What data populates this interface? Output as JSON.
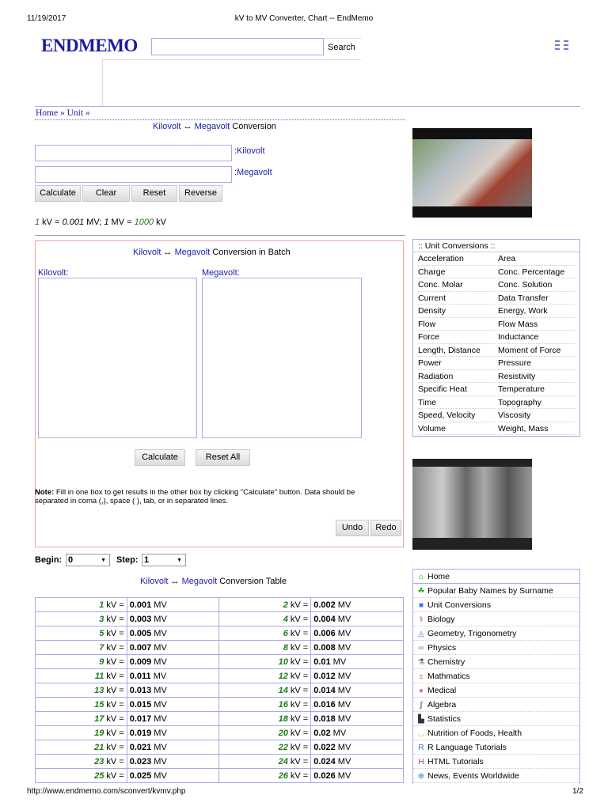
{
  "print_header": {
    "date": "11/19/2017",
    "title": "kV to MV Converter, Chart -- EndMemo"
  },
  "header": {
    "logo": "ENDMEMO",
    "search_placeholder": "",
    "search_button": "Search",
    "menu_icon": "menu-grid-icon"
  },
  "breadcrumb": {
    "home": "Home",
    "sep": " » ",
    "unit": "Unit",
    "end": " »"
  },
  "converter": {
    "from": "Kilovolt",
    "arrow": " ↔ ",
    "to": "Megavolt",
    "suffix": " Conversion",
    "label_from": ":Kilovolt",
    "label_to": ":Megavolt",
    "buttons": [
      "Calculate",
      "Clear",
      "Reset",
      "Reverse"
    ],
    "formula": {
      "a": "1",
      "b": " kV = ",
      "c": "0.001",
      "d": " MV; ",
      "e": "1",
      "f": " MV = ",
      "g": "1000",
      "h": " kV"
    }
  },
  "batch": {
    "from": "Kilovolt",
    "arrow": " ↔ ",
    "to": "Megavolt",
    "suffix": " Conversion in Batch",
    "label_from": "Kilovolt:",
    "label_to": "Megavolt:",
    "calculate": "Calculate",
    "reset_all": "Reset All",
    "note_label": "Note:",
    "note": " Fill in one box to get results in the other box by clicking \"Calculate\" button. Data should be separated in coma (,), space ( ), tab, or in separated lines.",
    "undo": "Undo",
    "redo": "Redo"
  },
  "unit_conversions": {
    "title": ":: Unit Conversions ::",
    "items": [
      "Acceleration",
      "Area",
      "Charge",
      "Conc. Percentage",
      "Conc. Molar",
      "Conc. Solution",
      "Current",
      "Data Transfer",
      "Density",
      "Energy, Work",
      "Flow",
      "Flow Mass",
      "Force",
      "Inductance",
      "Length, Distance",
      "Moment of Force",
      "Power",
      "Pressure",
      "Radiation",
      "Resistivity",
      "Specific Heat",
      "Temperature",
      "Time",
      "Topography",
      "Speed, Velocity",
      "Viscosity",
      "Volume",
      "Weight, Mass"
    ]
  },
  "table_controls": {
    "begin_label": "Begin:",
    "begin_value": "0",
    "step_label": "Step:",
    "step_value": "1"
  },
  "table": {
    "from": "Kilovolt",
    "arrow": " ↔ ",
    "to": "Megavolt",
    "suffix": " Conversion Table",
    "kv_unit": " kV =",
    "mv_unit": " MV",
    "rows": [
      [
        "1",
        "0.001",
        "2",
        "0.002"
      ],
      [
        "3",
        "0.003",
        "4",
        "0.004"
      ],
      [
        "5",
        "0.005",
        "6",
        "0.006"
      ],
      [
        "7",
        "0.007",
        "8",
        "0.008"
      ],
      [
        "9",
        "0.009",
        "10",
        "0.01"
      ],
      [
        "11",
        "0.011",
        "12",
        "0.012"
      ],
      [
        "13",
        "0.013",
        "14",
        "0.014"
      ],
      [
        "15",
        "0.015",
        "16",
        "0.016"
      ],
      [
        "17",
        "0.017",
        "18",
        "0.018"
      ],
      [
        "19",
        "0.019",
        "20",
        "0.02"
      ],
      [
        "21",
        "0.021",
        "22",
        "0.022"
      ],
      [
        "23",
        "0.023",
        "24",
        "0.024"
      ],
      [
        "25",
        "0.025",
        "26",
        "0.026"
      ]
    ]
  },
  "nav": [
    {
      "icon": "home-icon",
      "g": "⌂",
      "c": "#2a8a2a",
      "label": "Home"
    },
    {
      "icon": "person-icon",
      "g": "☘",
      "c": "#22aa22",
      "label": "Popular Baby Names by Surname"
    },
    {
      "icon": "units-icon",
      "g": "■",
      "c": "#3a7ae0",
      "label": "Unit Conversions"
    },
    {
      "icon": "biology-icon",
      "g": "⚕",
      "c": "#c03030",
      "label": "Biology"
    },
    {
      "icon": "geometry-icon",
      "g": "◬",
      "c": "#3a7ae0",
      "label": "Geometry, Trigonometry"
    },
    {
      "icon": "physics-icon",
      "g": "∞",
      "c": "#888",
      "label": "Physics"
    },
    {
      "icon": "chemistry-icon",
      "g": "⚗",
      "c": "#555",
      "label": "Chemistry"
    },
    {
      "icon": "math-icon",
      "g": "±",
      "c": "#e08030",
      "label": "Mathmatics"
    },
    {
      "icon": "medical-icon",
      "g": "●",
      "c": "#e07090",
      "label": "Medical"
    },
    {
      "icon": "algebra-icon",
      "g": "∫",
      "c": "#333",
      "label": "Algebra"
    },
    {
      "icon": "statistics-icon",
      "g": "▙",
      "c": "#333",
      "label": "Statistics"
    },
    {
      "icon": "banana-icon",
      "g": "◡",
      "c": "#e0b020",
      "label": "Nutrition of Foods, Health"
    },
    {
      "icon": "r-icon",
      "g": "R",
      "c": "#4070c0",
      "label": "R Language Tutorials"
    },
    {
      "icon": "html-icon",
      "g": "H",
      "c": "#c03030",
      "label": "HTML Tutorials"
    },
    {
      "icon": "globe-icon",
      "g": "⊕",
      "c": "#2080d0",
      "label": "News, Events Worldwide"
    }
  ],
  "footer": {
    "url": "http://www.endmemo.com/sconvert/kvmv.php",
    "page": "1/2"
  },
  "colors": {
    "link": "#1a1aa8",
    "green": "#1a7a1a",
    "batch_border": "#f0a0a0"
  }
}
